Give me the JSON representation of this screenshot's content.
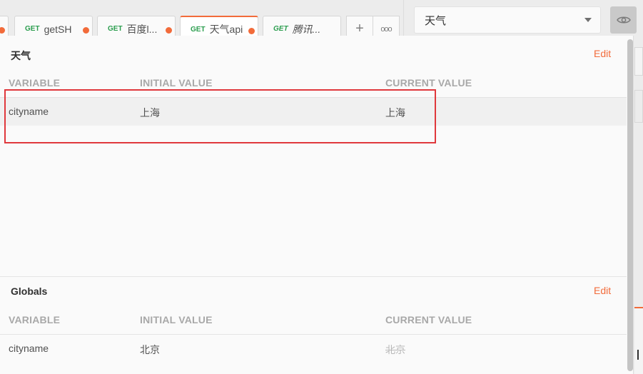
{
  "tabs": [
    {
      "method": "GET",
      "name": "getSH",
      "dirty": true,
      "active": false
    },
    {
      "method": "GET",
      "name": "百度l...",
      "dirty": true,
      "active": false
    },
    {
      "method": "GET",
      "name": "天气api",
      "dirty": true,
      "active": true
    },
    {
      "method": "GET",
      "name": "腾讯...",
      "dirty": false,
      "active": false,
      "italic": true
    }
  ],
  "tab_actions": {
    "add": "+",
    "more": "ooo"
  },
  "environment": {
    "selected": "天气",
    "eye_icon": "eye-icon"
  },
  "env_section": {
    "title": "天气",
    "edit": "Edit",
    "columns": {
      "variable": "VARIABLE",
      "initial": "INITIAL VALUE",
      "current": "CURRENT VALUE"
    },
    "rows": [
      {
        "variable": "cityname",
        "initial": "上海",
        "current": "上海"
      }
    ]
  },
  "globals_section": {
    "title": "Globals",
    "edit": "Edit",
    "columns": {
      "variable": "VARIABLE",
      "initial": "INITIAL VALUE",
      "current": "CURRENT VALUE"
    },
    "rows": [
      {
        "variable": "cityname",
        "initial": "北京",
        "current": "北京"
      }
    ]
  },
  "colors": {
    "accent": "#f26b3a",
    "method_get": "#2b9d4e",
    "annotation": "#e0383c"
  }
}
